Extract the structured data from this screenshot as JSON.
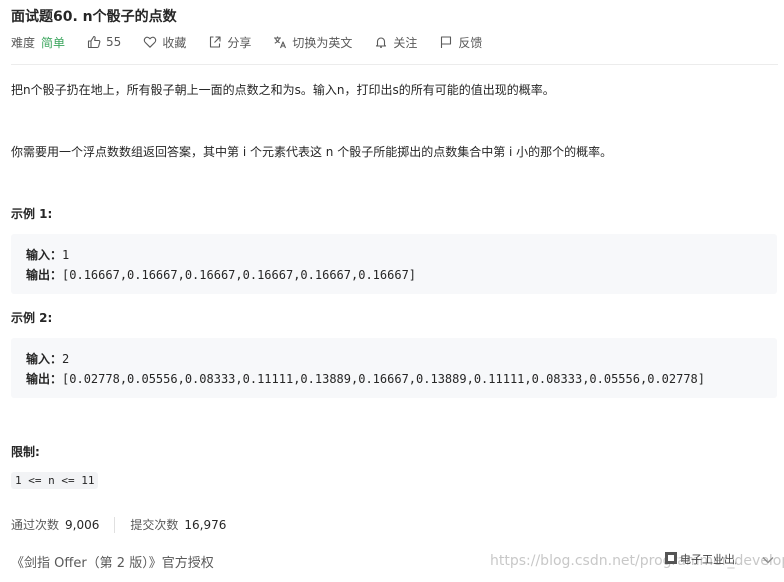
{
  "problem": {
    "title": "面试题60. n个骰子的点数",
    "difficulty_label": "难度",
    "difficulty_value": "简单",
    "likes": "55",
    "favorite_label": "收藏",
    "share_label": "分享",
    "translate_label": "切换为英文",
    "follow_label": "关注",
    "feedback_label": "反馈"
  },
  "description": {
    "p1": "把n个骰子扔在地上，所有骰子朝上一面的点数之和为s。输入n，打印出s的所有可能的值出现的概率。",
    "p2": "你需要用一个浮点数数组返回答案，其中第 i 个元素代表这 n 个骰子所能掷出的点数集合中第 i 小的那个的概率。"
  },
  "examples": [
    {
      "heading": "示例 1:",
      "input_label": "输入：",
      "input": "1",
      "output_label": "输出：",
      "output": "[0.16667,0.16667,0.16667,0.16667,0.16667,0.16667]"
    },
    {
      "heading": "示例 2:",
      "input_label": "输入：",
      "input": "2",
      "output_label": "输出：",
      "output": "[0.02778,0.05556,0.08333,0.11111,0.13889,0.16667,0.13889,0.11111,0.08333,0.05556,0.02778]"
    }
  ],
  "constraints": {
    "heading": "限制:",
    "value": "1 <= n <= 11"
  },
  "stats": {
    "accepted_label": "通过次数",
    "accepted_value": "9,006",
    "submitted_label": "提交次数",
    "submitted_value": "16,976"
  },
  "source": "《剑指 Offer（第 2 版）》官方授权",
  "watermark": "https://blog.csdn.net/programmer_developer",
  "colors": {
    "easy": "#3ba55d",
    "code_background": "#f7f8fa"
  },
  "icons": [
    "thumbs-up-icon",
    "heart-icon",
    "share-icon",
    "translate-icon",
    "bell-icon",
    "flag-icon",
    "chevron-down-icon"
  ]
}
